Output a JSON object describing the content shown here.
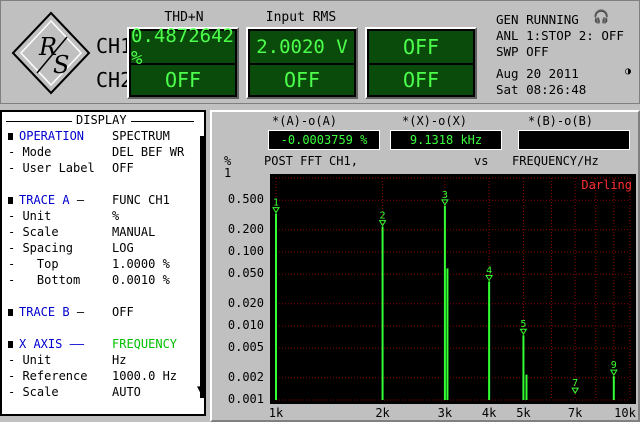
{
  "header": {
    "col1": "THD+N",
    "col2": "Input RMS",
    "ch1": "CH1",
    "ch2": "CH2",
    "ch1_thd": "0.4872642 %",
    "ch2_thd": "OFF",
    "ch1_rms": "2.0020  V",
    "ch2_rms": "OFF",
    "ch1_col3": "OFF",
    "ch2_col3": "OFF",
    "status_line1": "GEN RUNNING",
    "status_line2": "ANL 1:STOP 2: OFF",
    "status_line3": "SWP OFF",
    "date": "Aug 20 2011",
    "time": "Sat 08:26:48",
    "logo_text": "RS"
  },
  "menu": {
    "title": "DISPLAY",
    "rows": [
      {
        "key": "OPERATION",
        "value": "SPECTRUM"
      },
      {
        "key": "- Mode",
        "value": "DEL BEF WR"
      },
      {
        "key": "- User Label",
        "value": "OFF"
      },
      {
        "key": "TRACE A",
        "sep": "—",
        "value": "FUNC CH1"
      },
      {
        "key": "- Unit",
        "value": "%"
      },
      {
        "key": "- Scale",
        "value": "MANUAL"
      },
      {
        "key": "- Spacing",
        "value": "LOG"
      },
      {
        "key": "-   Top",
        "value": "1.0000 %"
      },
      {
        "key": "-   Bottom",
        "value": "0.0010 %"
      },
      {
        "key": "TRACE B",
        "sep": "—",
        "value": "OFF"
      },
      {
        "key": "X AXIS",
        "sep": "——",
        "value": "FREQUENCY"
      },
      {
        "key": "- Unit",
        "value": "Hz"
      },
      {
        "key": "- Reference",
        "value": "1000.0 Hz"
      },
      {
        "key": "- Scale",
        "value": "AUTO"
      }
    ]
  },
  "graph": {
    "cursor_a_label": "*(A)-o(A)",
    "cursor_a_value": "-0.0003759 %",
    "cursor_x_label": "*(X)-o(X)",
    "cursor_x_value": "9.1318 kHz",
    "cursor_b_label": "*(B)-o(B)",
    "cursor_b_value": "",
    "y_unit": "%",
    "y_top": "1",
    "title_left": "POST FFT CH1,",
    "title_mid": "vs",
    "title_right": "FREQUENCY/Hz",
    "window_label": "Darling"
  },
  "colors": {
    "trace": "#33ff33",
    "grid": "#8b0000",
    "window_label": "#ff3030",
    "lcd_bg": "#0a4a0a",
    "lcd_text": "#3cff3c"
  },
  "chart_data": {
    "type": "bar",
    "x_scale": "log",
    "y_scale": "log",
    "xlim": [
      1000,
      10000
    ],
    "ylim": [
      0.001,
      1
    ],
    "xlabel": "FREQUENCY/Hz",
    "ylabel": "%",
    "x_ticks": [
      {
        "v": 1000,
        "label": "1k"
      },
      {
        "v": 2000,
        "label": "2k"
      },
      {
        "v": 3000,
        "label": "3k"
      },
      {
        "v": 4000,
        "label": "4k"
      },
      {
        "v": 5000,
        "label": "5k"
      },
      {
        "v": 7000,
        "label": "7k"
      },
      {
        "v": 10000,
        "label": "10k"
      }
    ],
    "y_ticks": [
      {
        "v": 0.5,
        "label": "0.500"
      },
      {
        "v": 0.2,
        "label": "0.200"
      },
      {
        "v": 0.1,
        "label": "0.100"
      },
      {
        "v": 0.05,
        "label": "0.050"
      },
      {
        "v": 0.02,
        "label": "0.020"
      },
      {
        "v": 0.01,
        "label": "0.010"
      },
      {
        "v": 0.005,
        "label": "0.005"
      },
      {
        "v": 0.002,
        "label": "0.002"
      },
      {
        "v": 0.001,
        "label": "0.001"
      }
    ],
    "harmonic_markers": [
      {
        "label": "1",
        "x": 1000,
        "y": 0.33
      },
      {
        "label": "2",
        "x": 2000,
        "y": 0.22
      },
      {
        "label": "3",
        "x": 3000,
        "y": 0.42
      },
      {
        "label": "4",
        "x": 4000,
        "y": 0.04
      },
      {
        "label": "5",
        "x": 5000,
        "y": 0.0075
      },
      {
        "label": "7",
        "x": 7000,
        "y": 0.0012
      },
      {
        "label": "9",
        "x": 9000,
        "y": 0.0021
      }
    ],
    "series": [
      {
        "values": [
          {
            "x": 1000,
            "y": 0.33
          },
          {
            "x": 2000,
            "y": 0.22
          },
          {
            "x": 3000,
            "y": 0.42
          },
          {
            "x": 3050,
            "y": 0.06
          },
          {
            "x": 4000,
            "y": 0.04
          },
          {
            "x": 5000,
            "y": 0.0075
          },
          {
            "x": 5100,
            "y": 0.0022
          },
          {
            "x": 9000,
            "y": 0.0021
          }
        ]
      }
    ]
  }
}
